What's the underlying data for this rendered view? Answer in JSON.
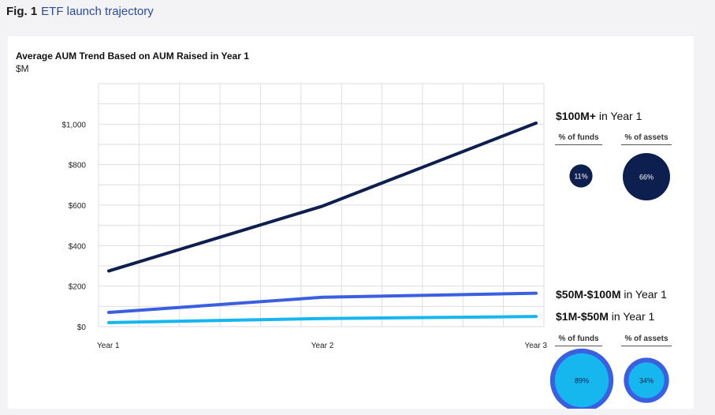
{
  "figure": {
    "label": "Fig. 1",
    "caption": "ETF launch trajectory"
  },
  "chart_data": {
    "type": "line",
    "title": "Average AUM Trend Based on AUM Raised in Year 1",
    "ylabel": "$M",
    "xlabel": "",
    "categories": [
      "Year 1",
      "Year 2",
      "Year 3"
    ],
    "ylim": [
      0,
      1200
    ],
    "yticks": [
      0,
      200,
      400,
      600,
      800,
      1000
    ],
    "ytick_labels": [
      "$0",
      "$200",
      "$400",
      "$600",
      "$800",
      "$1,000"
    ],
    "grid": true,
    "series": [
      {
        "key": "large",
        "color": "#0d1f4f",
        "values": [
          275,
          595,
          1005
        ]
      },
      {
        "key": "mid",
        "color": "#3a5fe0",
        "values": [
          70,
          145,
          165
        ]
      },
      {
        "key": "small",
        "color": "#16b6ee",
        "values": [
          20,
          40,
          50
        ]
      }
    ]
  },
  "groups": {
    "large": {
      "label_bold": "$100M+",
      "label_rest": " in Year 1"
    },
    "mid": {
      "label_bold": "$50M-$100M",
      "label_rest": " in Year 1"
    },
    "small": {
      "label_bold": "$1M-$50M",
      "label_rest": " in Year 1"
    }
  },
  "stats": {
    "top": {
      "funds_header": "% of funds",
      "assets_header": "% of assets",
      "funds_value": "11%",
      "assets_value": "66%",
      "funds_share": 11,
      "assets_share": 66
    },
    "bottom": {
      "funds_header": "% of funds",
      "assets_header": "% of assets",
      "funds_value": "89%",
      "assets_value": "34%",
      "funds_share": 89,
      "assets_share": 34
    }
  },
  "colors": {
    "large": "#0d1f4f",
    "mid": "#3a5fe0",
    "small": "#16b6ee",
    "grid": "#dedee3"
  }
}
